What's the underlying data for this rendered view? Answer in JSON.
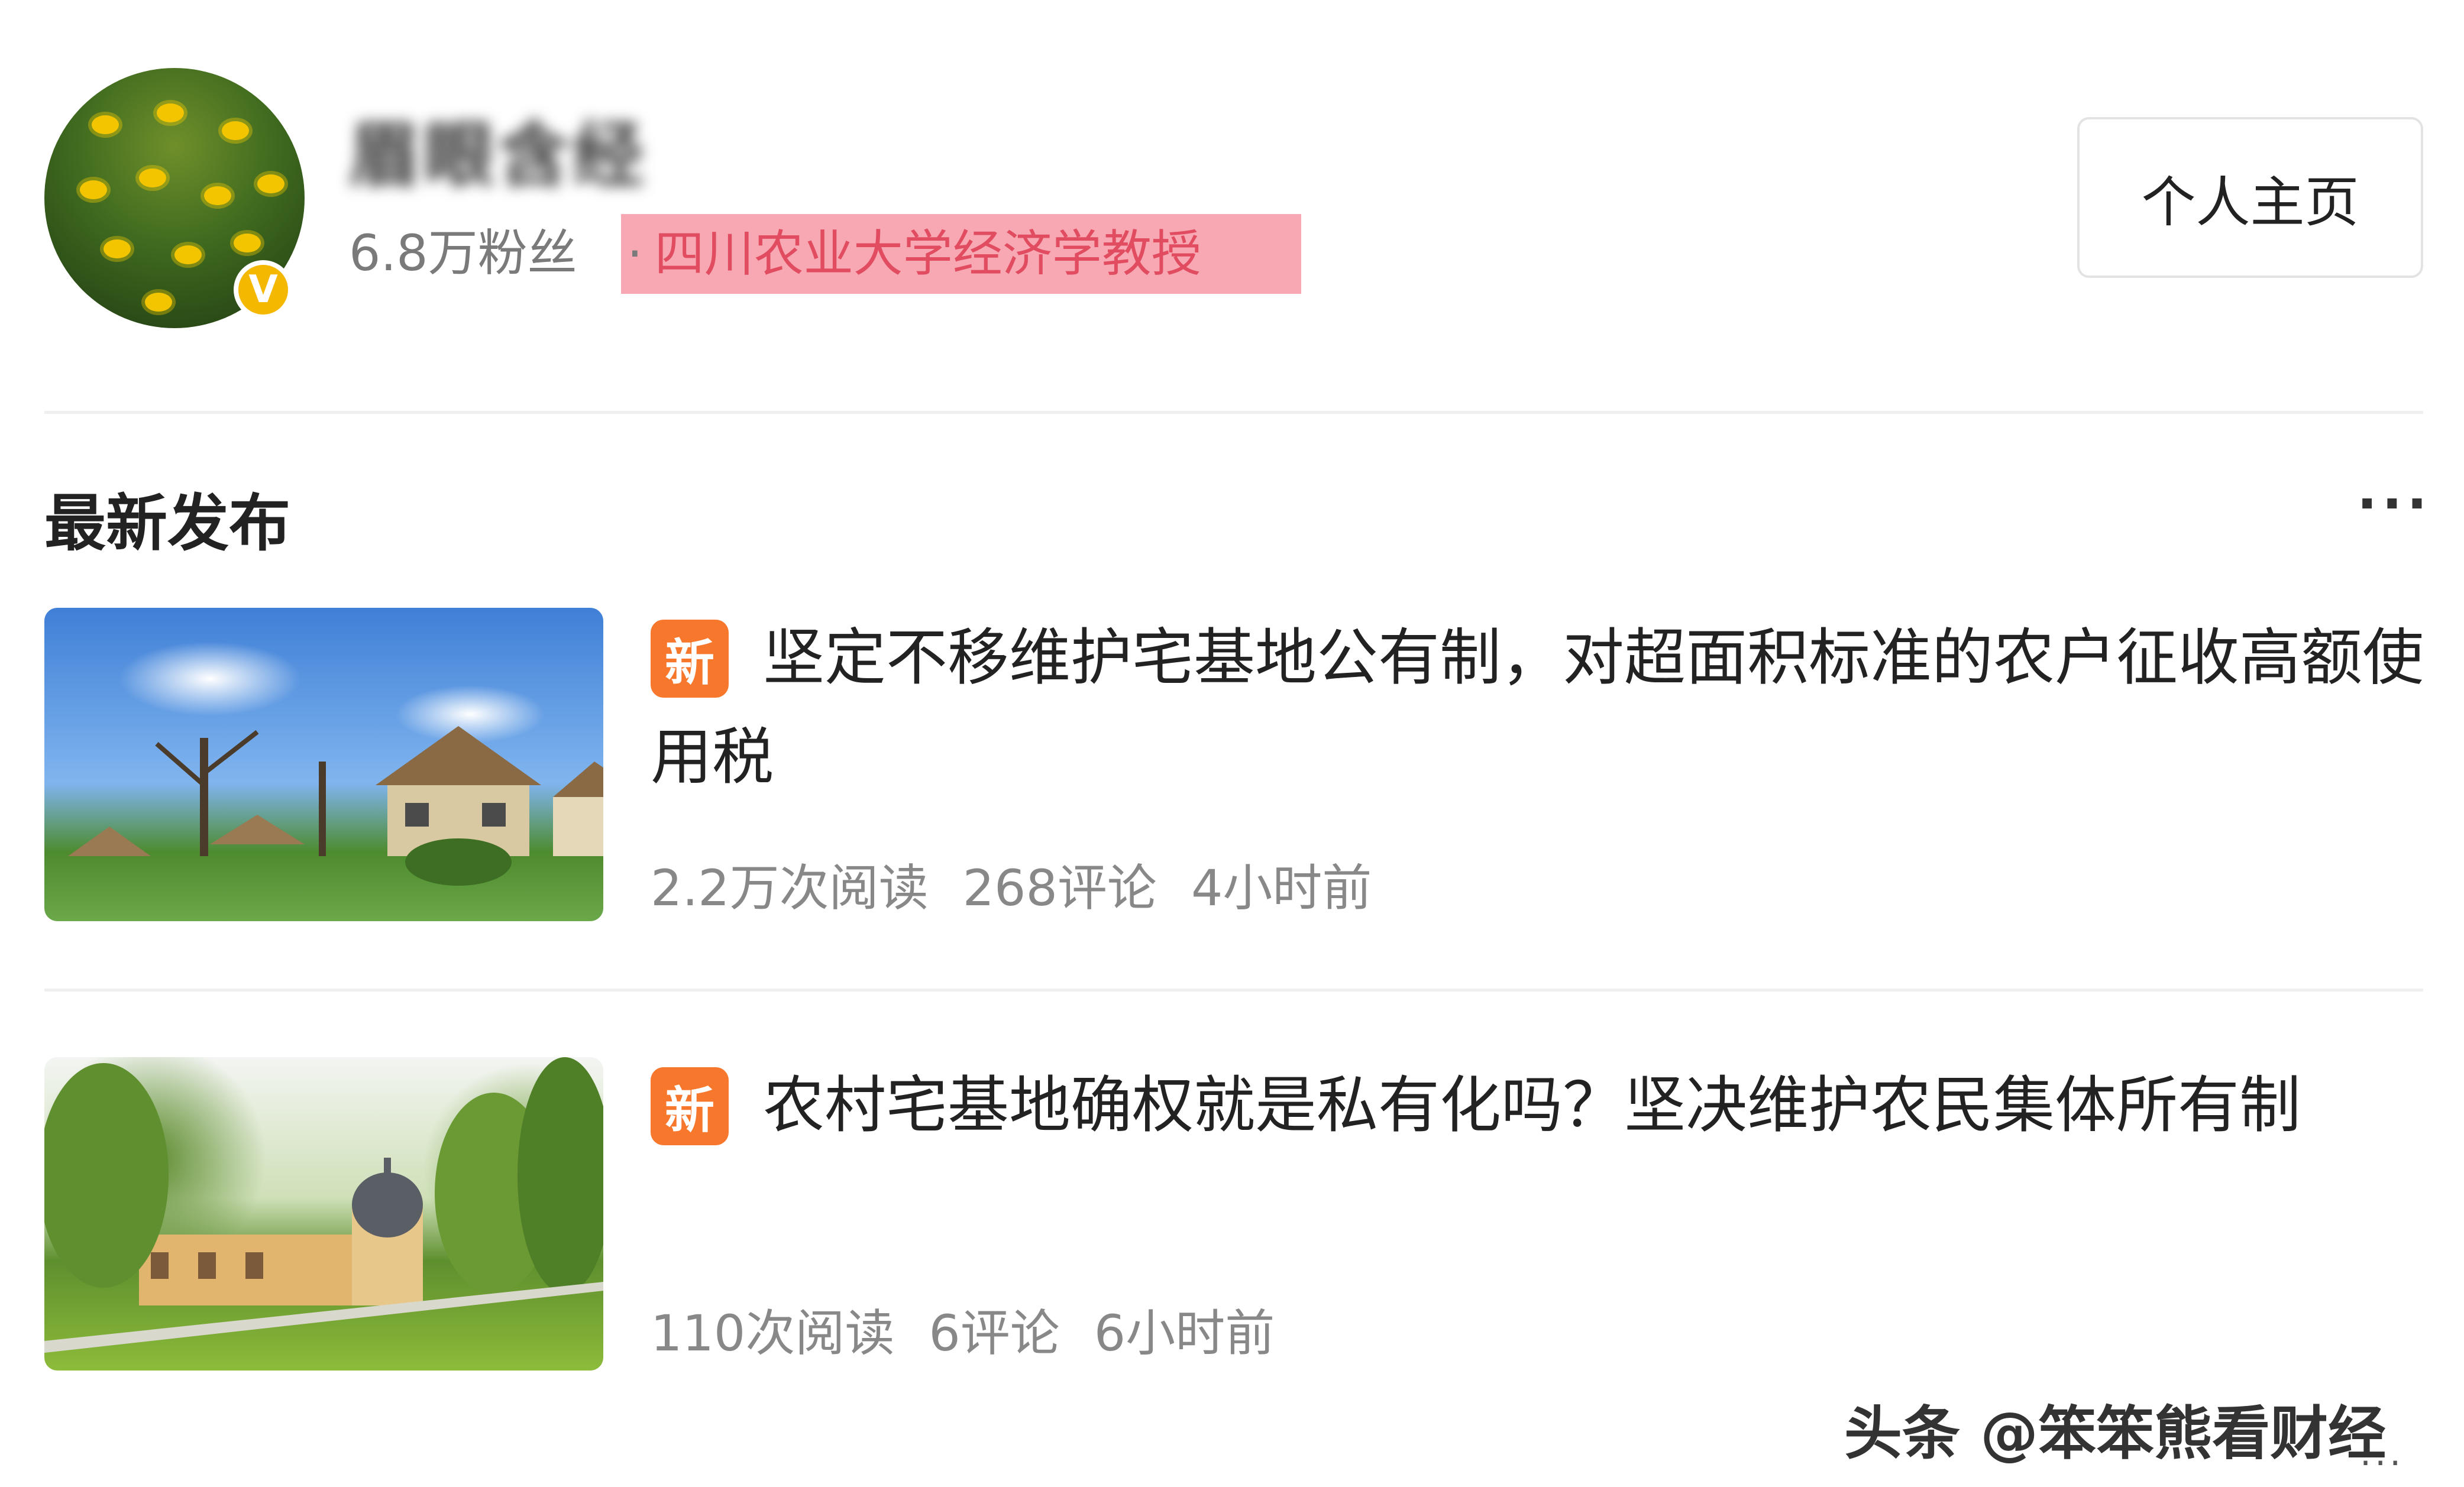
{
  "profile": {
    "username": "眉眼含经",
    "followers": "6.8万粉丝",
    "separator": "·",
    "organization": "四川农业大学经济学教授",
    "verified_badge": "V",
    "profile_button": "个人主页"
  },
  "section": {
    "title": "最新发布",
    "more": "···"
  },
  "articles": [
    {
      "badge": "新",
      "title": "坚定不移维护宅基地公有制，对超面积标准的农户征收高额使用税",
      "reads": "2.2万次阅读",
      "comments": "268评论",
      "time": "4小时前",
      "thumbnail": "countryside-house-photo"
    },
    {
      "badge": "新",
      "title": "农村宅基地确权就是私有化吗？坚决维护农民集体所有制",
      "reads": "110次阅读",
      "comments": "6评论",
      "time": "6小时前",
      "thumbnail": "park-building-photo"
    }
  ],
  "watermark": {
    "text": "头条 @笨笨熊看财经",
    "dots": "···"
  },
  "colors": {
    "badge_orange": "#f7772c",
    "highlight_pink": "#f7a8b2",
    "verified_gold": "#f5b800"
  }
}
